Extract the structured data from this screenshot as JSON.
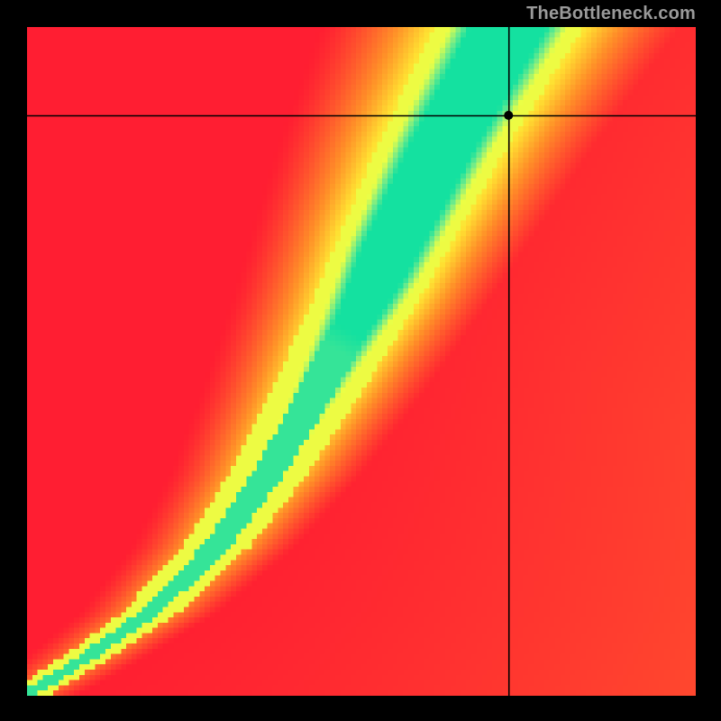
{
  "watermark": "TheBottleneck.com",
  "colors": {
    "background": "#000000",
    "crosshair": "#000000",
    "marker": "#000000"
  },
  "chart_data": {
    "type": "heatmap",
    "title": "",
    "xlabel": "",
    "ylabel": "",
    "xlim": [
      0,
      1
    ],
    "ylim": [
      0,
      1
    ],
    "grid_size": 128,
    "ridge_control_points": [
      [
        0.0,
        0.0
      ],
      [
        0.08,
        0.05
      ],
      [
        0.18,
        0.12
      ],
      [
        0.28,
        0.22
      ],
      [
        0.36,
        0.33
      ],
      [
        0.43,
        0.45
      ],
      [
        0.5,
        0.58
      ],
      [
        0.56,
        0.7
      ],
      [
        0.62,
        0.82
      ],
      [
        0.67,
        0.91
      ],
      [
        0.72,
        1.0
      ]
    ],
    "ridge_half_width_frac": 0.055,
    "gradient_stops": [
      [
        0.0,
        [
          255,
          30,
          50
        ]
      ],
      [
        0.4,
        [
          255,
          145,
          40
        ]
      ],
      [
        0.65,
        [
          255,
          225,
          50
        ]
      ],
      [
        0.82,
        [
          235,
          255,
          70
        ]
      ],
      [
        0.92,
        [
          110,
          235,
          140
        ]
      ],
      [
        1.0,
        [
          20,
          225,
          160
        ]
      ]
    ],
    "crosshair": {
      "x_frac": 0.72,
      "y_frac": 0.868
    },
    "marker": {
      "x_frac": 0.72,
      "y_frac": 0.868,
      "radius_px": 5
    }
  }
}
